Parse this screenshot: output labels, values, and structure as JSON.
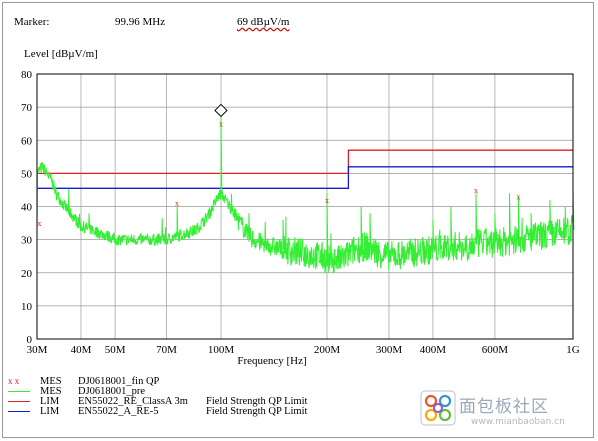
{
  "header": {
    "marker_label": "Marker:",
    "marker_freq": "99.96 MHz",
    "marker_level": "69 dBµV/m"
  },
  "colors": {
    "trace": "#33ee33",
    "limit_class_a": "#e02020",
    "limit_re5": "#1a1ad0",
    "final_marker": "#e02020",
    "grid": "#9a9a9a"
  },
  "legend": [
    {
      "symbol": "x x",
      "type": "MES",
      "name": "DJ0618001_fin QP",
      "desc": ""
    },
    {
      "symbol": "",
      "type": "MES",
      "name": "DJ0618001_pre",
      "desc": ""
    },
    {
      "symbol": "",
      "type": "LIM",
      "name": "EN55022_RE_ClassA 3m",
      "desc": "Field Strength QP Limit"
    },
    {
      "symbol": "",
      "type": "LIM",
      "name": "EN55022_A_RE-5",
      "desc": "Field Strength QP Limit"
    }
  ],
  "watermark": {
    "icon_name": "mianbaoban-logo-icon",
    "text": "面包板社区",
    "url": "www.mianbaoban.cn"
  },
  "chart_data": {
    "type": "line",
    "title": "",
    "ylabel": "Level [dBµV/m]",
    "xlabel": "Frequency [Hz]",
    "x_scale": "log",
    "xlim_mhz": [
      30,
      1000
    ],
    "ylim": [
      0,
      80
    ],
    "yticks": [
      0,
      10,
      20,
      30,
      40,
      50,
      60,
      70,
      80
    ],
    "xticks": [
      {
        "value": 30,
        "label": "30M"
      },
      {
        "value": 40,
        "label": "40M"
      },
      {
        "value": 50,
        "label": "50M"
      },
      {
        "value": 70,
        "label": "70M"
      },
      {
        "value": 100,
        "label": "100M"
      },
      {
        "value": 200,
        "label": "200M"
      },
      {
        "value": 300,
        "label": "300M"
      },
      {
        "value": 400,
        "label": "400M"
      },
      {
        "value": 600,
        "label": "600M"
      },
      {
        "value": 1000,
        "label": "1G"
      }
    ],
    "grid": true,
    "limits": [
      {
        "name": "EN55022_RE_ClassA 3m",
        "points": [
          [
            30,
            50
          ],
          [
            230,
            50
          ],
          [
            230,
            57
          ],
          [
            1000,
            57
          ]
        ]
      },
      {
        "name": "EN55022_A_RE-5",
        "points": [
          [
            30,
            45.5
          ],
          [
            230,
            45.5
          ],
          [
            230,
            52
          ],
          [
            1000,
            52
          ]
        ]
      }
    ],
    "final_qp_points": [
      {
        "mhz": 30.5,
        "level": 35
      },
      {
        "mhz": 75,
        "level": 41
      },
      {
        "mhz": 100,
        "level": 65
      },
      {
        "mhz": 200,
        "level": 42
      },
      {
        "mhz": 530,
        "level": 45
      },
      {
        "mhz": 700,
        "level": 43
      }
    ],
    "marker": {
      "mhz": 99.96,
      "level": 69
    },
    "prescan": {
      "name": "DJ0618001_pre",
      "base": [
        [
          30,
          50
        ],
        [
          31,
          52
        ],
        [
          32,
          50
        ],
        [
          33,
          48
        ],
        [
          34,
          44
        ],
        [
          36,
          40
        ],
        [
          38,
          37
        ],
        [
          40,
          34
        ],
        [
          43,
          33
        ],
        [
          45,
          32
        ],
        [
          48,
          31
        ],
        [
          50,
          30
        ],
        [
          55,
          30
        ],
        [
          60,
          30
        ],
        [
          65,
          30
        ],
        [
          70,
          30
        ],
        [
          75,
          31
        ],
        [
          80,
          32
        ],
        [
          85,
          33
        ],
        [
          90,
          36
        ],
        [
          94,
          39
        ],
        [
          97,
          42
        ],
        [
          100,
          44
        ],
        [
          103,
          42
        ],
        [
          106,
          40
        ],
        [
          110,
          37
        ],
        [
          115,
          34
        ],
        [
          120,
          31
        ],
        [
          130,
          29
        ],
        [
          140,
          28
        ],
        [
          150,
          27
        ],
        [
          170,
          26
        ],
        [
          190,
          25
        ],
        [
          200,
          24
        ],
        [
          220,
          24
        ],
        [
          240,
          27
        ],
        [
          260,
          28
        ],
        [
          280,
          26
        ],
        [
          300,
          25
        ],
        [
          350,
          26
        ],
        [
          400,
          27
        ],
        [
          450,
          28
        ],
        [
          500,
          28
        ],
        [
          550,
          29
        ],
        [
          600,
          29
        ],
        [
          700,
          30
        ],
        [
          800,
          31
        ],
        [
          900,
          32
        ],
        [
          1000,
          33
        ]
      ],
      "spikes": [
        [
          75,
          40
        ],
        [
          100,
          68
        ],
        [
          120,
          38
        ],
        [
          150,
          36
        ],
        [
          200,
          44
        ],
        [
          250,
          40
        ],
        [
          265,
          38
        ],
        [
          400,
          36
        ],
        [
          450,
          40
        ],
        [
          530,
          44
        ],
        [
          600,
          38
        ],
        [
          660,
          44
        ],
        [
          700,
          43
        ],
        [
          760,
          38
        ],
        [
          860,
          42
        ],
        [
          950,
          40
        ],
        [
          1000,
          45
        ]
      ]
    }
  }
}
